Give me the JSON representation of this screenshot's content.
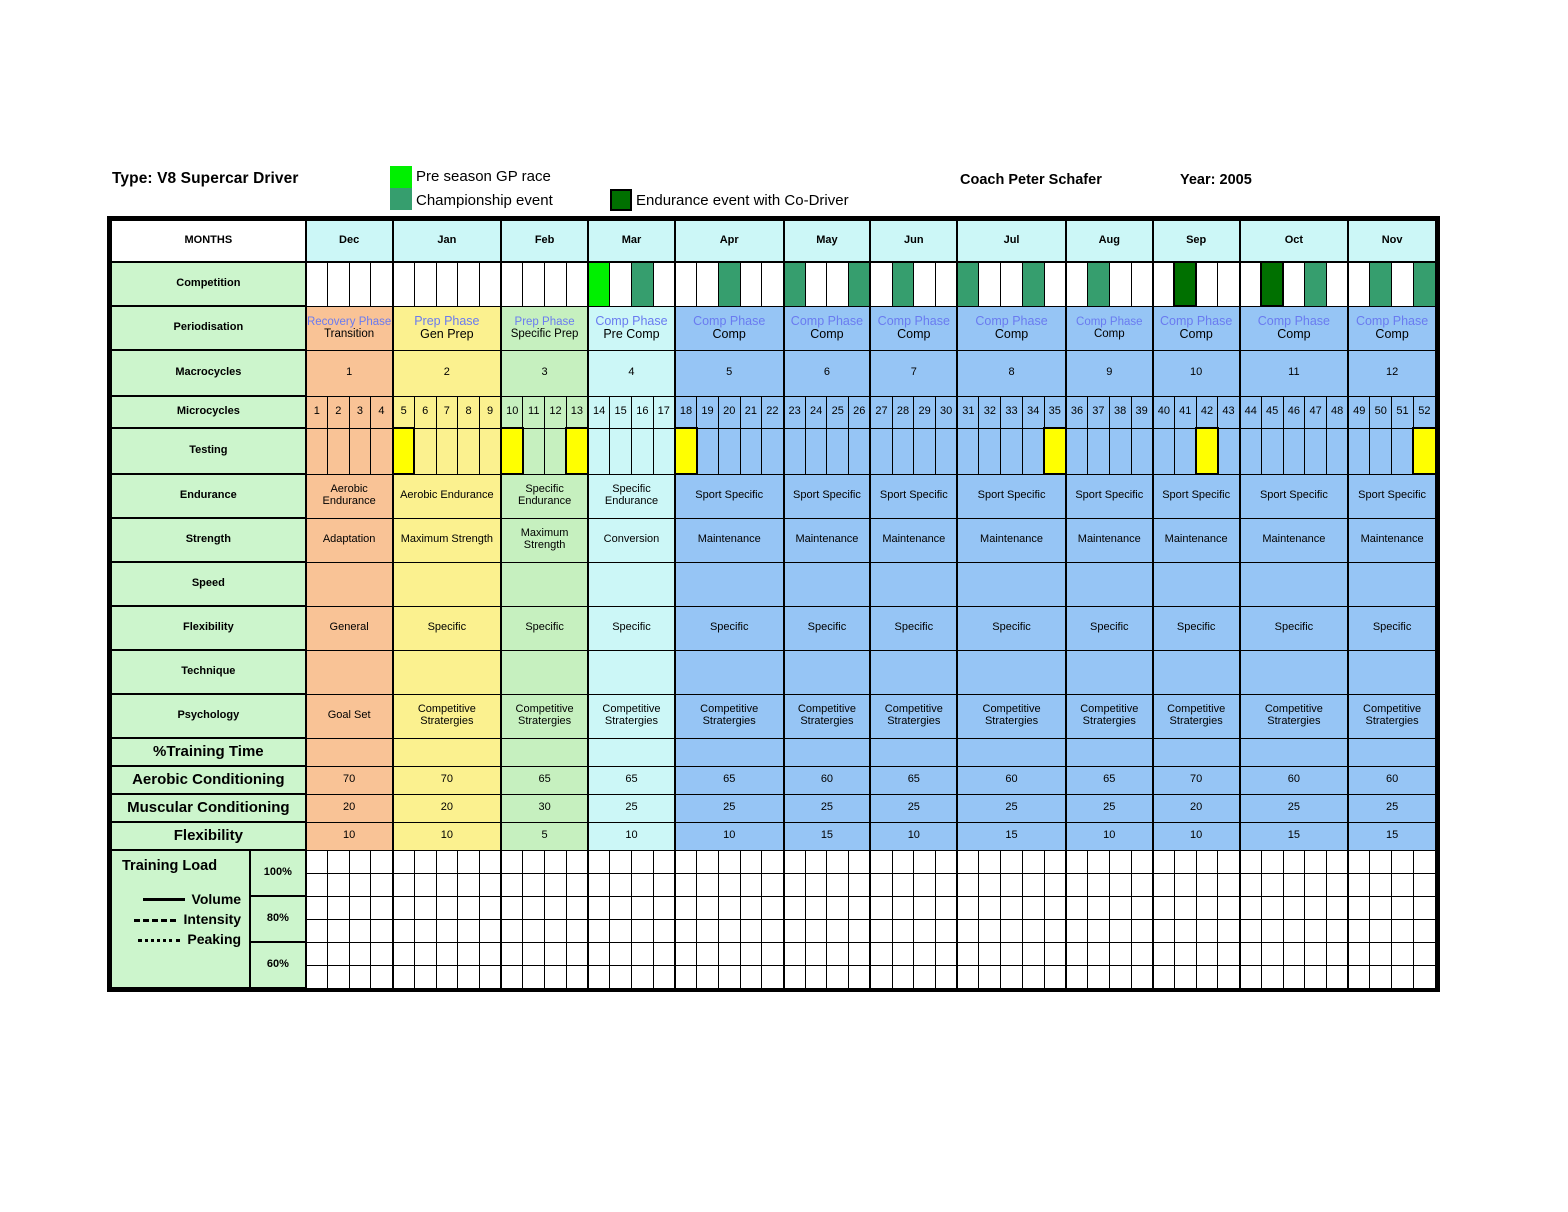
{
  "header": {
    "type_label": "Type: V8 Supercar Driver",
    "coach_label": "Coach Peter Schafer",
    "year_label": "Year: 2005",
    "legend": [
      {
        "label": "Pre season GP race",
        "color": "#00f000",
        "key": "pre"
      },
      {
        "label": "Championship event",
        "color": "#369e6e",
        "key": "champ"
      },
      {
        "label": "Endurance event with Co-Driver",
        "color": "#007000",
        "key": "endurance"
      }
    ]
  },
  "row_labels": {
    "months": "MONTHS",
    "competition": "Competition",
    "periodisation": "Periodisation",
    "macrocycles": "Macrocycles",
    "microcycles": "Microcycles",
    "testing": "Testing",
    "endurance": "Endurance",
    "strength": "Strength",
    "speed": "Speed",
    "flexibility": "Flexibility",
    "technique": "Technique",
    "psychology": "Psychology",
    "training_time": "%Training Time",
    "aerobic_conditioning": "Aerobic Conditioning",
    "muscular_conditioning": "Muscular Conditioning",
    "flexibility_pct": "Flexibility"
  },
  "months": [
    {
      "name": "Dec",
      "weeks": 4
    },
    {
      "name": "Jan",
      "weeks": 5
    },
    {
      "name": "Feb",
      "weeks": 4
    },
    {
      "name": "Mar",
      "weeks": 4
    },
    {
      "name": "Apr",
      "weeks": 5
    },
    {
      "name": "May",
      "weeks": 4
    },
    {
      "name": "Jun",
      "weeks": 4
    },
    {
      "name": "Jul",
      "weeks": 5
    },
    {
      "name": "Aug",
      "weeks": 4
    },
    {
      "name": "Sep",
      "weeks": 4
    },
    {
      "name": "Oct",
      "weeks": 5
    },
    {
      "name": "Nov",
      "weeks": 4
    }
  ],
  "total_weeks": 52,
  "competition_events": {
    "pre": [
      14
    ],
    "champ": [
      16,
      20,
      23,
      26,
      28,
      31,
      34,
      37,
      47,
      50,
      52
    ],
    "endurance": [
      41,
      45
    ]
  },
  "testing_weeks": [
    5,
    10,
    13,
    18,
    35,
    42,
    52
  ],
  "macrocycles": [
    {
      "number": "1",
      "months": 1,
      "bg": "trans"
    },
    {
      "number": "2",
      "months": 1,
      "bg": "gen"
    },
    {
      "number": "3",
      "months": 1,
      "bg": "spec"
    },
    {
      "number": "4",
      "months": 1,
      "bg": "pre"
    },
    {
      "number": "5",
      "months": 1,
      "bg": "comp"
    },
    {
      "number": "6",
      "months": 1,
      "bg": "comp"
    },
    {
      "number": "7",
      "months": 1,
      "bg": "comp"
    },
    {
      "number": "8",
      "months": 1,
      "bg": "comp"
    },
    {
      "number": "9",
      "months": 1,
      "bg": "comp"
    },
    {
      "number": "10",
      "months": 1,
      "bg": "comp"
    },
    {
      "number": "11",
      "months": 1,
      "bg": "comp"
    },
    {
      "number": "12",
      "months": 1,
      "bg": "comp"
    }
  ],
  "periodisation": [
    {
      "phase": "Recovery Phase",
      "sub": "Transition",
      "bg": "trans",
      "small": true
    },
    {
      "phase": "Prep Phase",
      "sub": "Gen  Prep",
      "bg": "gen",
      "small": false
    },
    {
      "phase": "Prep Phase",
      "sub": "Specific Prep",
      "bg": "spec",
      "small": true
    },
    {
      "phase": "Comp Phase",
      "sub": "Pre Comp",
      "bg": "pre",
      "small": false
    },
    {
      "phase": "Comp Phase",
      "sub": "Comp",
      "bg": "comp",
      "small": false
    },
    {
      "phase": "Comp Phase",
      "sub": "Comp",
      "bg": "comp",
      "small": false
    },
    {
      "phase": "Comp Phase",
      "sub": "Comp",
      "bg": "comp",
      "small": false
    },
    {
      "phase": "Comp Phase",
      "sub": "Comp",
      "bg": "comp",
      "small": false
    },
    {
      "phase": "Comp Phase",
      "sub": "Comp",
      "bg": "comp",
      "small": true
    },
    {
      "phase": "Comp Phase",
      "sub": "Comp",
      "bg": "comp",
      "small": false
    },
    {
      "phase": "Comp Phase",
      "sub": "Comp",
      "bg": "comp",
      "small": false
    },
    {
      "phase": "Comp Phase",
      "sub": "Comp",
      "bg": "comp",
      "small": false
    }
  ],
  "endurance_row": [
    {
      "text": "Aerobic Endurance",
      "bg": "trans"
    },
    {
      "text": "Aerobic Endurance",
      "bg": "gen"
    },
    {
      "text": "Specific Endurance",
      "bg": "spec"
    },
    {
      "text": "Specific Endurance",
      "bg": "pre"
    },
    {
      "text": "Sport Specific",
      "bg": "comp"
    },
    {
      "text": "Sport Specific",
      "bg": "comp"
    },
    {
      "text": "Sport Specific",
      "bg": "comp"
    },
    {
      "text": "Sport Specific",
      "bg": "comp"
    },
    {
      "text": "Sport Specific",
      "bg": "comp"
    },
    {
      "text": "Sport Specific",
      "bg": "comp"
    },
    {
      "text": "Sport Specific",
      "bg": "comp"
    },
    {
      "text": "Sport Specific",
      "bg": "comp"
    }
  ],
  "strength_row": [
    {
      "text": "Adaptation",
      "bg": "trans"
    },
    {
      "text": "Maximum Strength",
      "bg": "gen"
    },
    {
      "text": "Maximum Strength",
      "bg": "spec"
    },
    {
      "text": "Conversion",
      "bg": "pre"
    },
    {
      "text": "Maintenance",
      "bg": "comp"
    },
    {
      "text": "Maintenance",
      "bg": "comp"
    },
    {
      "text": "Maintenance",
      "bg": "comp"
    },
    {
      "text": "Maintenance",
      "bg": "comp"
    },
    {
      "text": "Maintenance",
      "bg": "comp"
    },
    {
      "text": "Maintenance",
      "bg": "comp"
    },
    {
      "text": "Maintenance",
      "bg": "comp"
    },
    {
      "text": "Maintenance",
      "bg": "comp"
    }
  ],
  "speed_row": [
    {
      "text": "",
      "bg": "trans"
    },
    {
      "text": "",
      "bg": "gen"
    },
    {
      "text": "",
      "bg": "spec"
    },
    {
      "text": "",
      "bg": "pre"
    },
    {
      "text": "",
      "bg": "comp"
    },
    {
      "text": "",
      "bg": "comp"
    },
    {
      "text": "",
      "bg": "comp"
    },
    {
      "text": "",
      "bg": "comp"
    },
    {
      "text": "",
      "bg": "comp"
    },
    {
      "text": "",
      "bg": "comp"
    },
    {
      "text": "",
      "bg": "comp"
    },
    {
      "text": "",
      "bg": "comp"
    }
  ],
  "flexibility_row": [
    {
      "text": "General",
      "bg": "trans"
    },
    {
      "text": "Specific",
      "bg": "gen"
    },
    {
      "text": "Specific",
      "bg": "spec"
    },
    {
      "text": "Specific",
      "bg": "pre"
    },
    {
      "text": "Specific",
      "bg": "comp"
    },
    {
      "text": "Specific",
      "bg": "comp"
    },
    {
      "text": "Specific",
      "bg": "comp"
    },
    {
      "text": "Specific",
      "bg": "comp"
    },
    {
      "text": "Specific",
      "bg": "comp"
    },
    {
      "text": "Specific",
      "bg": "comp"
    },
    {
      "text": "Specific",
      "bg": "comp"
    },
    {
      "text": "Specific",
      "bg": "comp"
    }
  ],
  "technique_row": [
    {
      "text": "",
      "bg": "trans"
    },
    {
      "text": "",
      "bg": "gen"
    },
    {
      "text": "",
      "bg": "spec"
    },
    {
      "text": "",
      "bg": "pre"
    },
    {
      "text": "",
      "bg": "comp"
    },
    {
      "text": "",
      "bg": "comp"
    },
    {
      "text": "",
      "bg": "comp"
    },
    {
      "text": "",
      "bg": "comp"
    },
    {
      "text": "",
      "bg": "comp"
    },
    {
      "text": "",
      "bg": "comp"
    },
    {
      "text": "",
      "bg": "comp"
    },
    {
      "text": "",
      "bg": "comp"
    }
  ],
  "psychology_row": [
    {
      "text": "Goal Set",
      "bg": "trans"
    },
    {
      "text": "Competitive Stratergies",
      "bg": "gen"
    },
    {
      "text": "Competitive Stratergies",
      "bg": "spec"
    },
    {
      "text": "Competitive Stratergies",
      "bg": "pre"
    },
    {
      "text": "Competitive Stratergies",
      "bg": "comp"
    },
    {
      "text": "Competitive Stratergies",
      "bg": "comp"
    },
    {
      "text": "Competitive Stratergies",
      "bg": "comp"
    },
    {
      "text": "Competitive Stratergies",
      "bg": "comp"
    },
    {
      "text": "Competitive Stratergies",
      "bg": "comp"
    },
    {
      "text": "Competitive Stratergies",
      "bg": "comp"
    },
    {
      "text": "Competitive Stratergies",
      "bg": "comp"
    },
    {
      "text": "Competitive Stratergies",
      "bg": "comp"
    }
  ],
  "training_time_row": [
    {
      "text": "",
      "bg": "trans"
    },
    {
      "text": "",
      "bg": "gen"
    },
    {
      "text": "",
      "bg": "spec"
    },
    {
      "text": "",
      "bg": "pre"
    },
    {
      "text": "",
      "bg": "comp"
    },
    {
      "text": "",
      "bg": "comp"
    },
    {
      "text": "",
      "bg": "comp"
    },
    {
      "text": "",
      "bg": "comp"
    },
    {
      "text": "",
      "bg": "comp"
    },
    {
      "text": "",
      "bg": "comp"
    },
    {
      "text": "",
      "bg": "comp"
    },
    {
      "text": "",
      "bg": "comp"
    }
  ],
  "aerobic_values": [
    "70",
    "70",
    "65",
    "65",
    "65",
    "60",
    "65",
    "60",
    "65",
    "70",
    "60",
    "60"
  ],
  "muscular_values": [
    "20",
    "20",
    "30",
    "25",
    "25",
    "25",
    "25",
    "25",
    "25",
    "20",
    "25",
    "25"
  ],
  "flex_values": [
    "10",
    "10",
    "5",
    "10",
    "10",
    "15",
    "10",
    "15",
    "10",
    "10",
    "15",
    "15"
  ],
  "training_load": {
    "title": "Training Load",
    "legend": [
      {
        "label": "Volume",
        "style": "solid"
      },
      {
        "label": "Intensity",
        "style": "dashed"
      },
      {
        "label": "Peaking",
        "style": "dotted"
      }
    ],
    "levels": [
      "100%",
      "80%",
      "60%"
    ],
    "grid_rows": 6
  },
  "chart_data": {
    "type": "table",
    "title": "V8 Supercar Driver Annual Training Periodisation Plan 2005",
    "categories": [
      "Dec",
      "Jan",
      "Feb",
      "Mar",
      "Apr",
      "May",
      "Jun",
      "Jul",
      "Aug",
      "Sep",
      "Oct",
      "Nov"
    ],
    "series": [
      {
        "name": "Aerobic Conditioning %",
        "values": [
          70,
          70,
          65,
          65,
          65,
          60,
          65,
          60,
          65,
          70,
          60,
          60
        ]
      },
      {
        "name": "Muscular Conditioning %",
        "values": [
          20,
          20,
          30,
          25,
          25,
          25,
          25,
          25,
          25,
          20,
          25,
          25
        ]
      },
      {
        "name": "Flexibility %",
        "values": [
          10,
          10,
          5,
          10,
          10,
          15,
          10,
          15,
          10,
          10,
          15,
          15
        ]
      }
    ],
    "xlabel": "Months",
    "ylabel": "% Training Time",
    "ylim": [
      0,
      100
    ],
    "grid": true,
    "legend_position": "top"
  }
}
